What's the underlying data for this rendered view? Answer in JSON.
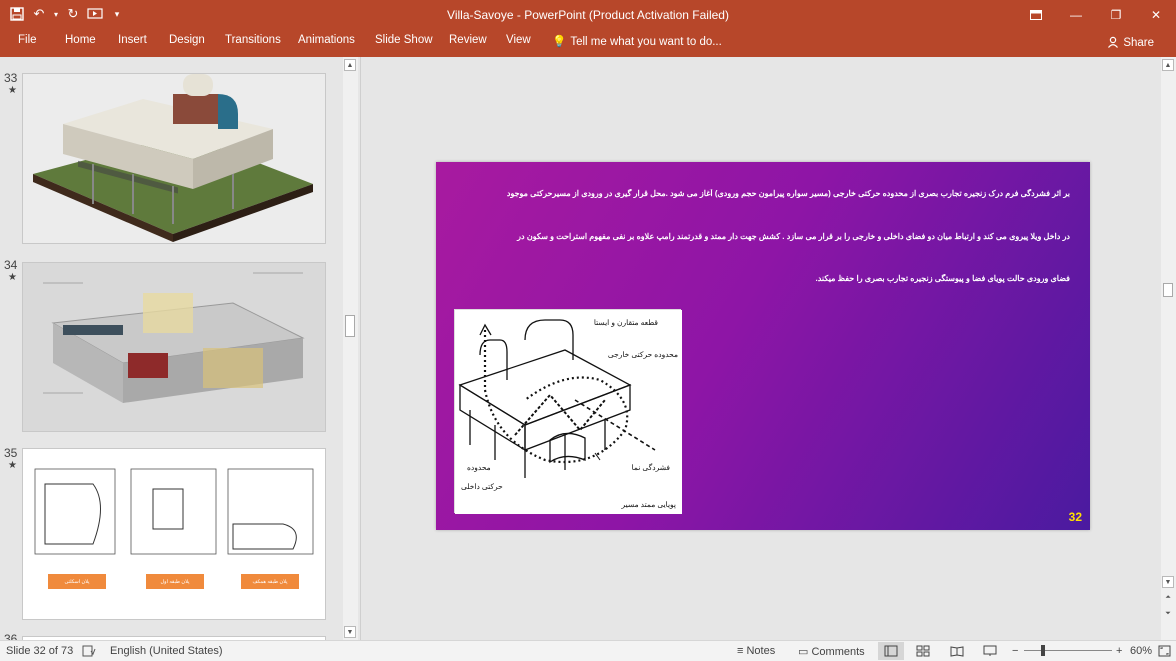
{
  "window": {
    "title": "Villa-Savoye - PowerPoint (Product Activation Failed)"
  },
  "ribbon": {
    "tabs": [
      "File",
      "Home",
      "Insert",
      "Design",
      "Transitions",
      "Animations",
      "Slide Show",
      "Review",
      "View"
    ],
    "tell_me": "Tell me what you want to do...",
    "share": "Share"
  },
  "thumbnails": [
    {
      "number": "33",
      "star": "★"
    },
    {
      "number": "34",
      "star": "★"
    },
    {
      "number": "35",
      "star": "★"
    },
    {
      "number": "36",
      "star": ""
    }
  ],
  "thumb35_buttons": [
    "پلان اسکلتی",
    "پلان طبقه اول",
    "پلان طبقه همکف"
  ],
  "slide": {
    "lines": [
      "بر اثر فشردگی فرم درک زنجیره تجارب بصری از محدوده حرکتی خارجی (مسیر سواره پیرامون حجم ورودی) آغاز می شود .محل قرار گیری در ورودی از مسیرحرکتی موجود",
      "در داخل ویلا پیروی می کند و ارتباط میان دو فضای داخلی و خارجی را بر قرار می سازد . کشش جهت دار ممتد و قدرتمند رامپ علاوه بر نفی مفهوم استراحت و سکون در",
      "فضای ورودی حالت پویای فضا و پیوستگی زنجیره تجارب بصری را حفظ میکند."
    ],
    "sketch_labels": {
      "top": "قطعه متقارن و ایستا",
      "outer": "محدوده حرکتی خارجی",
      "compress": "فشردگی نما",
      "inner_1": "محدوده",
      "inner_2": "حرکتی داخلی",
      "ramp": "پویایی ممتد مسیر"
    },
    "page_number": "32"
  },
  "status": {
    "slide_info": "Slide 32 of 73",
    "language": "English (United States)",
    "notes": "Notes",
    "comments": "Comments",
    "zoom": "60%"
  },
  "colors": {
    "accent": "#b7472a",
    "slide_page_number": "#ffe000"
  }
}
